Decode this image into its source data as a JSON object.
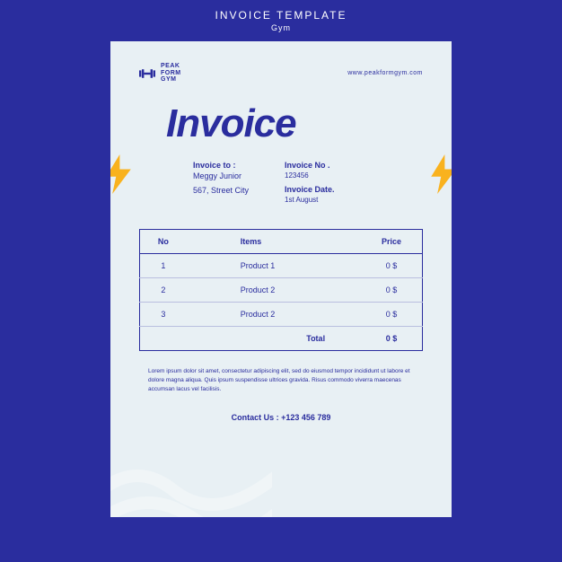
{
  "header": {
    "title": "INVOICE TEMPLATE",
    "subtitle": "Gym"
  },
  "logo": {
    "line1": "PEAK",
    "line2": "FORM",
    "line3": "GYM"
  },
  "website": "www.peakformgym.com",
  "title": "Invoice",
  "invoiceTo": {
    "label": "Invoice to :",
    "name": "Meggy Junior",
    "address": "567, Street City"
  },
  "invoiceMeta": {
    "noLabel": "Invoice No .",
    "no": "123456",
    "dateLabel": "Invoice Date.",
    "date": "1st August"
  },
  "table": {
    "headers": {
      "no": "No",
      "items": "Items",
      "price": "Price"
    },
    "rows": [
      {
        "no": "1",
        "item": "Product 1",
        "price": "0 $"
      },
      {
        "no": "2",
        "item": "Product 2",
        "price": "0 $"
      },
      {
        "no": "3",
        "item": "Product 2",
        "price": "0 $"
      }
    ],
    "totalLabel": "Total",
    "totalValue": "0 $"
  },
  "lorem": "Lorem ipsum dolor sit amet, consectetur adipiscing elit, sed do eiusmod tempor incididunt ut labore et dolore magna aliqua. Quis ipsum suspendisse ultrices gravida. Risus commodo viverra maecenas accumsan lacus vel facilisis.",
  "contact": {
    "label": "Contact Us : ",
    "number": "+123 456 789"
  }
}
